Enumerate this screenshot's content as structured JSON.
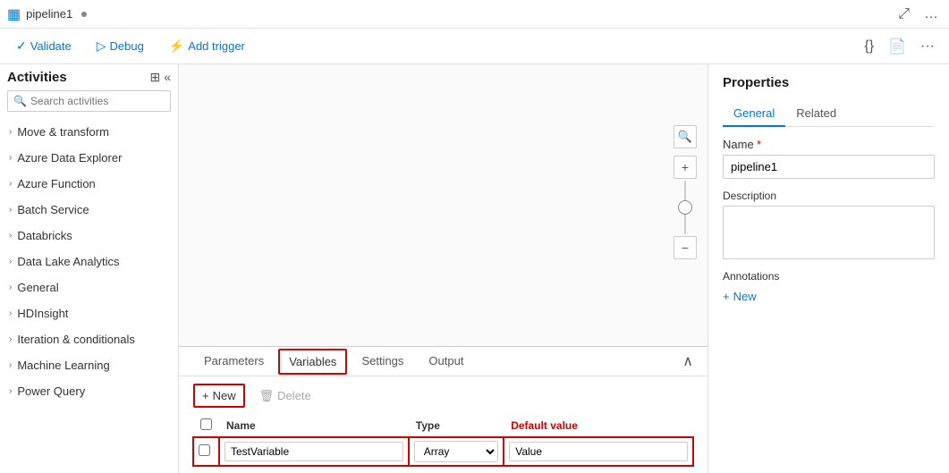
{
  "topbar": {
    "pipeline_icon": "▦",
    "title": "pipeline1",
    "dot": "•",
    "expand_icon": "⤢",
    "more_icon": "…"
  },
  "toolbar": {
    "validate_label": "Validate",
    "debug_label": "Debug",
    "add_trigger_label": "Add trigger",
    "validate_icon": "✓",
    "debug_icon": "▷",
    "trigger_icon": "⚡",
    "code_icon": "{}",
    "doc_icon": "📄",
    "more_icon": "···"
  },
  "sidebar": {
    "title": "Activities",
    "collapse_icon": "«",
    "search_placeholder": "Search activities",
    "items": [
      {
        "label": "Move & transform"
      },
      {
        "label": "Azure Data Explorer"
      },
      {
        "label": "Azure Function"
      },
      {
        "label": "Batch Service"
      },
      {
        "label": "Databricks"
      },
      {
        "label": "Data Lake Analytics"
      },
      {
        "label": "General"
      },
      {
        "label": "HDInsight"
      },
      {
        "label": "Iteration & conditionals"
      },
      {
        "label": "Machine Learning"
      },
      {
        "label": "Power Query"
      }
    ]
  },
  "canvas_controls": {
    "search_icon": "🔍",
    "zoom_in": "+",
    "zoom_out": "−"
  },
  "bottom_panel": {
    "tabs": [
      {
        "label": "Parameters",
        "active": false
      },
      {
        "label": "Variables",
        "active": true,
        "highlight": true
      },
      {
        "label": "Settings",
        "active": false
      },
      {
        "label": "Output",
        "active": false
      }
    ],
    "collapse_icon": "∧",
    "actions": {
      "new_label": "New",
      "delete_label": "Delete",
      "new_icon": "+",
      "delete_icon": "🗑"
    },
    "table": {
      "headers": [
        "",
        "Name",
        "Type",
        "Default value"
      ],
      "rows": [
        {
          "name": "TestVariable",
          "type": "Array",
          "default_value": "Value",
          "highlighted": true
        }
      ]
    }
  },
  "properties": {
    "title": "Properties",
    "tabs": [
      {
        "label": "General",
        "active": true
      },
      {
        "label": "Related",
        "active": false
      }
    ],
    "name_label": "Name",
    "name_required": "*",
    "name_value": "pipeline1",
    "description_label": "Description",
    "description_value": "",
    "annotations_label": "Annotations",
    "add_new_label": "New",
    "add_icon": "+"
  }
}
